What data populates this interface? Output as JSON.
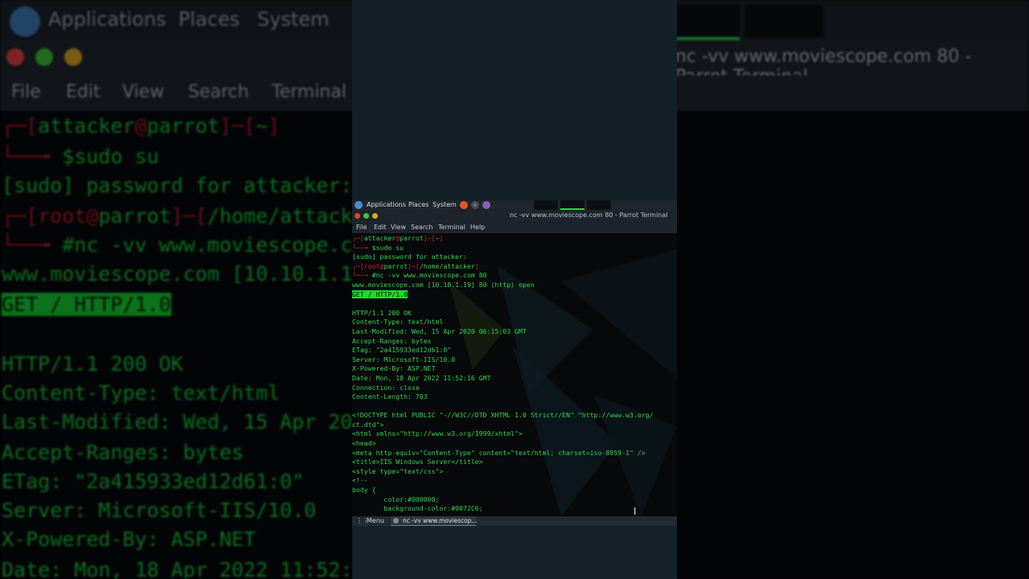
{
  "panel": {
    "items": [
      "Applications",
      "Places",
      "System"
    ],
    "launchers": [
      {
        "icon": "firefox-icon",
        "color": "#e25822"
      },
      {
        "icon": "terminal-icon",
        "color": "#4a4f57"
      },
      {
        "icon": "app-icon",
        "color": "#8a60b8"
      }
    ]
  },
  "window": {
    "title": "nc -vv www.moviescope.com 80 - Parrot Terminal",
    "menu": [
      "File",
      "Edit",
      "View",
      "Search",
      "Terminal",
      "Help"
    ],
    "buttons": {
      "close": "#e0443e",
      "minimize": "#3ec13b",
      "maximize": "#e0a826"
    }
  },
  "terminal": {
    "prompt1": {
      "user": "attacker",
      "host": "parrot",
      "dir": "~",
      "command": "$sudo su"
    },
    "sudo_prompt": "[sudo] password for attacker:",
    "prompt2": {
      "user": "root",
      "host": "parrot",
      "dir": "/home/attacker",
      "command": "#nc -vv www.moviescope.com 80"
    },
    "lines": [
      "www.moviescope.com [10.10.1.19] 80 (http) open",
      "GET / HTTP/1.0",
      "",
      "HTTP/1.1 200 OK",
      "Content-Type: text/html",
      "Last-Modified: Wed, 15 Apr 2020 06:15:03 GMT",
      "Accept-Ranges: bytes",
      "ETag: \"2a415933ed12d61:0\"",
      "Server: Microsoft-IIS/10.0",
      "X-Powered-By: ASP.NET",
      "Date: Mon, 18 Apr 2022 11:52:16 GMT",
      "Connection: close",
      "Content-Length: 703",
      "",
      "<!DOCTYPE html PUBLIC \"-//W3C//DTD XHTML 1.0 Strict//EN\" \"http://www.w3.org/",
      "ct.dtd\">",
      "<html xmlns=\"http://www.w3.org/1999/xhtml\">",
      "<head>",
      "<meta http-equiv=\"Content-Type\" content=\"text/html; charset=iso-8859-1\" />",
      "<title>IIS Windows Server</title>",
      "<style type=\"text/css\">",
      "<!--",
      "body {",
      "        color:#000000;",
      "        background-color:#0072C6;"
    ],
    "text_color": "#2fd44a",
    "highlight_color": "#19dd2f"
  },
  "taskbar": {
    "menu_label": "Menu",
    "task_label": "nc -vv www.moviescop..."
  }
}
